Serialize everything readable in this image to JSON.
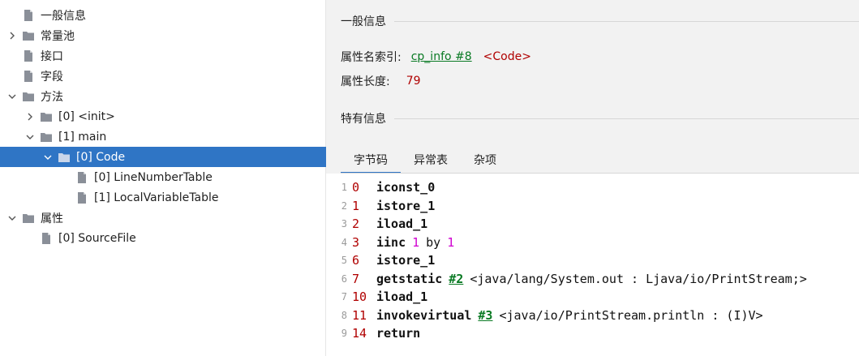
{
  "tree": [
    {
      "label": "一般信息",
      "level": 0,
      "chevron": "none",
      "icon": "file"
    },
    {
      "label": "常量池",
      "level": 0,
      "chevron": "right",
      "icon": "folder"
    },
    {
      "label": "接口",
      "level": 0,
      "chevron": "none",
      "icon": "file"
    },
    {
      "label": "字段",
      "level": 0,
      "chevron": "none",
      "icon": "file"
    },
    {
      "label": "方法",
      "level": 0,
      "chevron": "down",
      "icon": "folder"
    },
    {
      "label": "[0] <init>",
      "level": 1,
      "chevron": "right",
      "icon": "folder"
    },
    {
      "label": "[1] main",
      "level": 1,
      "chevron": "down",
      "icon": "folder"
    },
    {
      "label": "[0] Code",
      "level": 2,
      "chevron": "down",
      "icon": "folder",
      "selected": true
    },
    {
      "label": "[0] LineNumberTable",
      "level": 3,
      "chevron": "none",
      "icon": "file"
    },
    {
      "label": "[1] LocalVariableTable",
      "level": 3,
      "chevron": "none",
      "icon": "file"
    },
    {
      "label": "属性",
      "level": 0,
      "chevron": "down",
      "icon": "folder"
    },
    {
      "label": "[0] SourceFile",
      "level": 1,
      "chevron": "none",
      "icon": "file"
    }
  ],
  "general": {
    "header": "一般信息",
    "name_index_label": "属性名索引:",
    "name_index_link": "cp_info #8",
    "name_index_value": "<Code>",
    "length_label": "属性长度:",
    "length_value": "79"
  },
  "specific": {
    "header": "特有信息"
  },
  "tabs": [
    {
      "label": "字节码",
      "active": true
    },
    {
      "label": "异常表",
      "active": false
    },
    {
      "label": "杂项",
      "active": false
    }
  ],
  "code": [
    {
      "ln": "1",
      "off": "0",
      "op": "iconst_0"
    },
    {
      "ln": "2",
      "off": "1",
      "op": "istore_1"
    },
    {
      "ln": "3",
      "off": "2",
      "op": "iload_1"
    },
    {
      "ln": "4",
      "off": "3",
      "op": "iinc",
      "a": "1",
      "kw": "by",
      "b": "1"
    },
    {
      "ln": "5",
      "off": "6",
      "op": "istore_1"
    },
    {
      "ln": "6",
      "off": "7",
      "op": "getstatic",
      "ref": "#2",
      "text": "<java/lang/System.out : Ljava/io/PrintStream;>"
    },
    {
      "ln": "7",
      "off": "10",
      "op": "iload_1"
    },
    {
      "ln": "8",
      "off": "11",
      "op": "invokevirtual",
      "ref": "#3",
      "text": "<java/io/PrintStream.println : (I)V>"
    },
    {
      "ln": "9",
      "off": "14",
      "op": "return"
    }
  ],
  "colors": {
    "selection": "#2f75c5",
    "offset": "#b00000",
    "link": "#0a7a24",
    "number": "#d000d0"
  }
}
